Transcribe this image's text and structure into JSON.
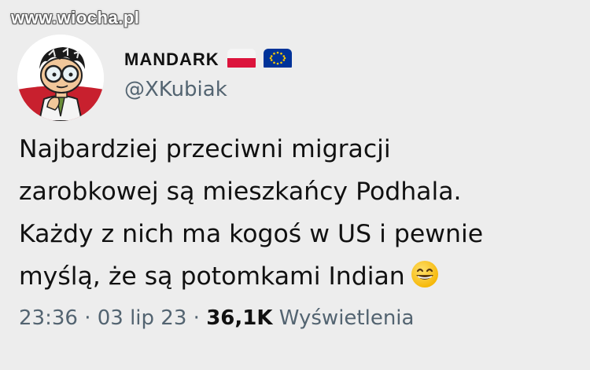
{
  "watermark": "www.wiocha.pl",
  "author": {
    "display_name": "MANDARK",
    "handle": "@XKubiak",
    "badges": [
      "flag-poland-icon",
      "flag-eu-icon"
    ]
  },
  "tweet": {
    "lines": [
      "Najbardziej przeciwni migracji",
      "zarobkowej są mieszkańcy Podhala.",
      "Każdy z nich ma kogoś w US i pewnie",
      "myślą, że są potomkami Indian"
    ],
    "emoji": "grinning-face-icon"
  },
  "meta": {
    "time": "23:36",
    "separator": " · ",
    "date": "03 lip 23",
    "views_count": "36,1K",
    "views_label": "Wyświetlenia"
  },
  "colors": {
    "background": "#ededed",
    "secondary_text": "#536471",
    "primary_text": "#111111"
  }
}
